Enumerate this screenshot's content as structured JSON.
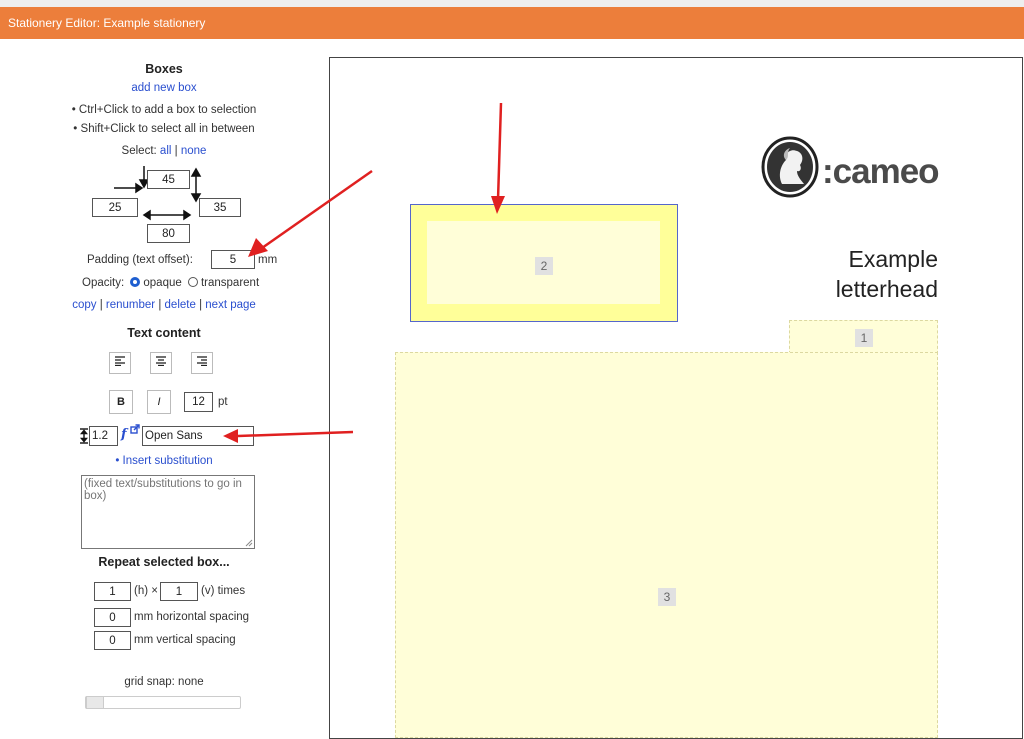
{
  "window": {
    "title": "Stationery Editor: Example stationery"
  },
  "boxes_panel": {
    "heading": "Boxes",
    "add_link": "add new box",
    "hint_ctrl": "• Ctrl+Click to add a box to selection",
    "hint_shift": "• Shift+Click to select all in between",
    "select_label": "Select:",
    "select_all": "all",
    "select_sep": "|",
    "select_none": "none",
    "pos_top": "45",
    "pos_left": "25",
    "pos_width": "35",
    "pos_height": "80",
    "padding_label": "Padding (text offset):",
    "padding_value": "5",
    "padding_unit": "mm",
    "opacity_label": "Opacity:",
    "opacity_opaque": "opaque",
    "opacity_transparent": "transparent",
    "action_copy": "copy",
    "action_renumber": "renumber",
    "action_delete": "delete",
    "action_next_page": "next page",
    "sep": "|"
  },
  "text_panel": {
    "heading": "Text content",
    "bold": "B",
    "italic": "I",
    "font_size": "12",
    "font_size_unit": "pt",
    "line_height": "1.2",
    "font_name": "Open Sans",
    "insert_substitution": "• Insert substitution",
    "content_placeholder": "(fixed text/substitutions to go in box)"
  },
  "repeat_panel": {
    "heading": "Repeat selected box...",
    "h_count": "1",
    "h_label": "(h) ×",
    "v_count": "1",
    "v_label": "(v) times",
    "h_spacing": "0",
    "h_spacing_label": "mm horizontal spacing",
    "v_spacing": "0",
    "v_spacing_label": "mm vertical spacing",
    "grid_snap_label": "grid snap: none"
  },
  "canvas": {
    "logo_text": ":cameo",
    "letterhead_line1": "Example",
    "letterhead_line2": "letterhead",
    "box_labels": [
      "2",
      "1",
      "3"
    ]
  },
  "colors": {
    "titlebar": "#ec7e3b",
    "link": "#2a4fcf",
    "selected_box_fill": "#ffff99",
    "box_fill": "#fffed8",
    "annotation_arrow": "#e02020"
  }
}
